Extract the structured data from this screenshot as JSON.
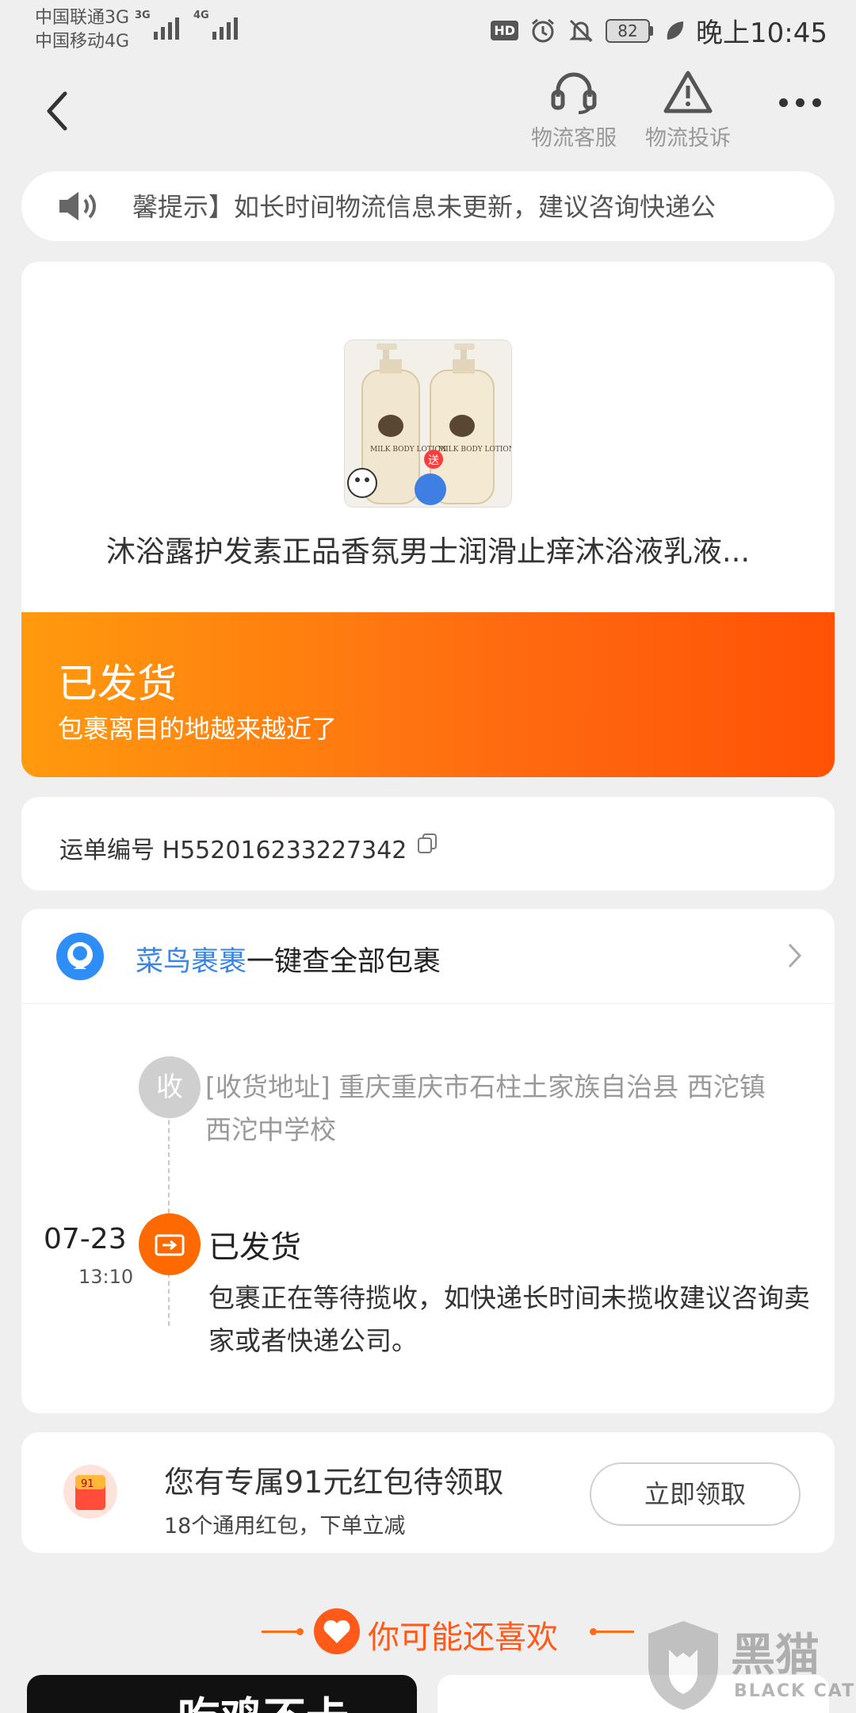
{
  "status_bar": {
    "carrier_1": "中国联通3G",
    "carrier_2": "中国移动4G",
    "signal_1_tag": "3G",
    "signal_2_tag": "4G",
    "hd_badge": "HD",
    "battery": "82",
    "time": "晚上10:45"
  },
  "header": {
    "service_label": "物流客服",
    "complaint_label": "物流投诉"
  },
  "notice": {
    "text": "馨提示】如长时间物流信息未更新，建议咨询快递公"
  },
  "product": {
    "title": "沐浴露护发素正品香氛男士润滑止痒沐浴液乳液...",
    "image_text": "MILK BODY LOTION",
    "gift_badge": "送"
  },
  "shipping": {
    "status": "已发货",
    "subtitle": "包裹离目的地越来越近了"
  },
  "waybill": {
    "text": "运单编号 H552016233227342"
  },
  "cainiao": {
    "brand": "菜鸟裹裹",
    "text": "一键查全部包裹"
  },
  "timeline": {
    "receive_node_label": "收",
    "receive_address": "[收货地址] 重庆重庆市石柱土家族自治县 西沱镇　西沱中学校",
    "events": [
      {
        "date": "07-23",
        "time": "13:10",
        "title": "已发货",
        "desc": "包裹正在等待揽收，如快递长时间未揽收建议咨询卖家或者快递公司。"
      }
    ]
  },
  "red_packet": {
    "title": "您有专属91元红包待领取",
    "subtitle": "18个通用红包，下单立减",
    "button": "立即领取",
    "icon_amount": "91"
  },
  "recommend": {
    "title": "你可能还喜欢"
  },
  "feed": {
    "tile_left_text": "吃鸡不卡"
  },
  "watermark": {
    "cn": "黑猫",
    "en": "BLACK CAT"
  },
  "colors": {
    "accent_orange": "#ff6a00",
    "link_blue": "#3a86e6"
  }
}
